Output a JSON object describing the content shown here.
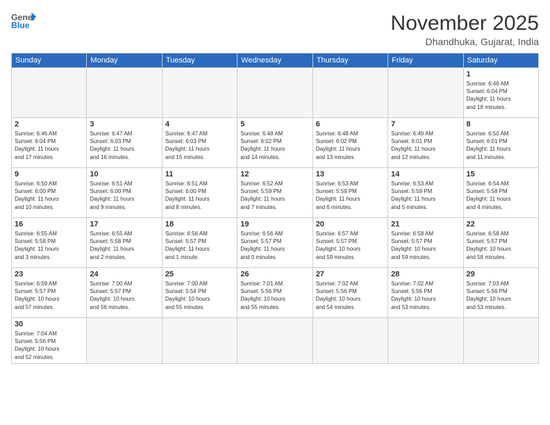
{
  "logo": {
    "general": "General",
    "blue": "Blue"
  },
  "title": "November 2025",
  "location": "Dhandhuka, Gujarat, India",
  "weekdays": [
    "Sunday",
    "Monday",
    "Tuesday",
    "Wednesday",
    "Thursday",
    "Friday",
    "Saturday"
  ],
  "weeks": [
    [
      {
        "day": "",
        "info": ""
      },
      {
        "day": "",
        "info": ""
      },
      {
        "day": "",
        "info": ""
      },
      {
        "day": "",
        "info": ""
      },
      {
        "day": "",
        "info": ""
      },
      {
        "day": "",
        "info": ""
      },
      {
        "day": "1",
        "info": "Sunrise: 6:46 AM\nSunset: 6:04 PM\nDaylight: 11 hours\nand 18 minutes."
      }
    ],
    [
      {
        "day": "2",
        "info": "Sunrise: 6:46 AM\nSunset: 6:04 PM\nDaylight: 11 hours\nand 17 minutes."
      },
      {
        "day": "3",
        "info": "Sunrise: 6:47 AM\nSunset: 6:03 PM\nDaylight: 11 hours\nand 16 minutes."
      },
      {
        "day": "4",
        "info": "Sunrise: 6:47 AM\nSunset: 6:03 PM\nDaylight: 11 hours\nand 15 minutes."
      },
      {
        "day": "5",
        "info": "Sunrise: 6:48 AM\nSunset: 6:02 PM\nDaylight: 11 hours\nand 14 minutes."
      },
      {
        "day": "6",
        "info": "Sunrise: 6:48 AM\nSunset: 6:02 PM\nDaylight: 11 hours\nand 13 minutes."
      },
      {
        "day": "7",
        "info": "Sunrise: 6:49 AM\nSunset: 6:01 PM\nDaylight: 11 hours\nand 12 minutes."
      },
      {
        "day": "8",
        "info": "Sunrise: 6:50 AM\nSunset: 6:01 PM\nDaylight: 11 hours\nand 11 minutes."
      }
    ],
    [
      {
        "day": "9",
        "info": "Sunrise: 6:50 AM\nSunset: 6:00 PM\nDaylight: 11 hours\nand 10 minutes."
      },
      {
        "day": "10",
        "info": "Sunrise: 6:51 AM\nSunset: 6:00 PM\nDaylight: 11 hours\nand 9 minutes."
      },
      {
        "day": "11",
        "info": "Sunrise: 6:51 AM\nSunset: 6:00 PM\nDaylight: 11 hours\nand 8 minutes."
      },
      {
        "day": "12",
        "info": "Sunrise: 6:52 AM\nSunset: 5:59 PM\nDaylight: 11 hours\nand 7 minutes."
      },
      {
        "day": "13",
        "info": "Sunrise: 6:53 AM\nSunset: 5:59 PM\nDaylight: 11 hours\nand 6 minutes."
      },
      {
        "day": "14",
        "info": "Sunrise: 6:53 AM\nSunset: 5:59 PM\nDaylight: 11 hours\nand 5 minutes."
      },
      {
        "day": "15",
        "info": "Sunrise: 6:54 AM\nSunset: 5:58 PM\nDaylight: 11 hours\nand 4 minutes."
      }
    ],
    [
      {
        "day": "16",
        "info": "Sunrise: 6:55 AM\nSunset: 5:58 PM\nDaylight: 11 hours\nand 3 minutes."
      },
      {
        "day": "17",
        "info": "Sunrise: 6:55 AM\nSunset: 5:58 PM\nDaylight: 11 hours\nand 2 minutes."
      },
      {
        "day": "18",
        "info": "Sunrise: 6:56 AM\nSunset: 5:57 PM\nDaylight: 11 hours\nand 1 minute."
      },
      {
        "day": "19",
        "info": "Sunrise: 6:56 AM\nSunset: 5:57 PM\nDaylight: 11 hours\nand 0 minutes."
      },
      {
        "day": "20",
        "info": "Sunrise: 6:57 AM\nSunset: 5:57 PM\nDaylight: 10 hours\nand 59 minutes."
      },
      {
        "day": "21",
        "info": "Sunrise: 6:58 AM\nSunset: 5:57 PM\nDaylight: 10 hours\nand 59 minutes."
      },
      {
        "day": "22",
        "info": "Sunrise: 6:58 AM\nSunset: 5:57 PM\nDaylight: 10 hours\nand 58 minutes."
      }
    ],
    [
      {
        "day": "23",
        "info": "Sunrise: 6:59 AM\nSunset: 5:57 PM\nDaylight: 10 hours\nand 57 minutes."
      },
      {
        "day": "24",
        "info": "Sunrise: 7:00 AM\nSunset: 5:57 PM\nDaylight: 10 hours\nand 56 minutes."
      },
      {
        "day": "25",
        "info": "Sunrise: 7:00 AM\nSunset: 5:56 PM\nDaylight: 10 hours\nand 55 minutes."
      },
      {
        "day": "26",
        "info": "Sunrise: 7:01 AM\nSunset: 5:56 PM\nDaylight: 10 hours\nand 55 minutes."
      },
      {
        "day": "27",
        "info": "Sunrise: 7:02 AM\nSunset: 5:56 PM\nDaylight: 10 hours\nand 54 minutes."
      },
      {
        "day": "28",
        "info": "Sunrise: 7:02 AM\nSunset: 5:56 PM\nDaylight: 10 hours\nand 53 minutes."
      },
      {
        "day": "29",
        "info": "Sunrise: 7:03 AM\nSunset: 5:56 PM\nDaylight: 10 hours\nand 53 minutes."
      }
    ],
    [
      {
        "day": "30",
        "info": "Sunrise: 7:04 AM\nSunset: 5:56 PM\nDaylight: 10 hours\nand 52 minutes."
      },
      {
        "day": "",
        "info": ""
      },
      {
        "day": "",
        "info": ""
      },
      {
        "day": "",
        "info": ""
      },
      {
        "day": "",
        "info": ""
      },
      {
        "day": "",
        "info": ""
      },
      {
        "day": "",
        "info": ""
      }
    ]
  ]
}
